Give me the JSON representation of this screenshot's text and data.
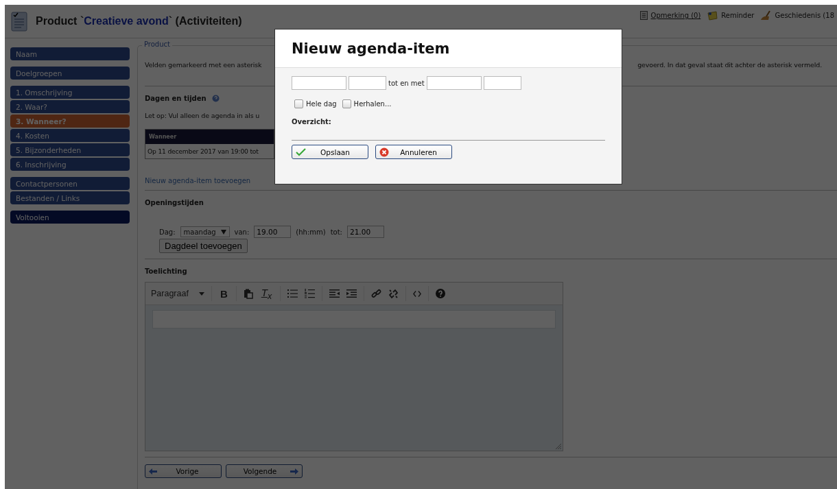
{
  "header": {
    "title_prefix": "Product `",
    "title_name": "Creatieve avond",
    "title_suffix": "` (Activiteiten)",
    "links": [
      {
        "kind": "note",
        "label": "Opmerking (0)"
      },
      {
        "kind": "reminder",
        "label": "Reminder"
      },
      {
        "kind": "history",
        "label": "Geschiedenis (18"
      }
    ]
  },
  "sidebar": {
    "groups": [
      [
        {
          "label": "Naam",
          "selected": false,
          "kind": "step"
        }
      ],
      [
        {
          "label": "Doelgroepen",
          "selected": false,
          "kind": "step"
        }
      ],
      [
        {
          "label": "1. Omschrijving",
          "selected": false,
          "kind": "step"
        },
        {
          "label": "2. Waar?",
          "selected": false,
          "kind": "step"
        },
        {
          "label": "3. Wanneer?",
          "selected": true,
          "kind": "step"
        },
        {
          "label": "4. Kosten",
          "selected": false,
          "kind": "step"
        },
        {
          "label": "5. Bijzonderheden",
          "selected": false,
          "kind": "step"
        },
        {
          "label": "6. Inschrijving",
          "selected": false,
          "kind": "step"
        }
      ],
      [
        {
          "label": "Contactpersonen",
          "selected": false,
          "kind": "step"
        },
        {
          "label": "Bestanden / Links",
          "selected": false,
          "kind": "step"
        }
      ],
      [
        {
          "label": "Voltooien",
          "selected": false,
          "kind": "finish"
        }
      ]
    ]
  },
  "content": {
    "legend": "Product",
    "intro_left": "Velden gemarkeerd met een asterisk",
    "intro_right": "gevoerd. In dat geval staat dit achter de asterisk vermeld.",
    "days_heading": "Dagen en tijden",
    "days_note": "Let op: Vul alleen de agenda in als u",
    "table": {
      "columns": [
        "Wanneer"
      ],
      "rows": [
        [
          "Op 11 december 2017 van 19:00 tot"
        ]
      ]
    },
    "add_link": "Nieuw agenda-item toevoegen",
    "opening": {
      "heading": "Openingstijden",
      "day_label": "Dag:",
      "day_value": "maandag",
      "from_label": "van:",
      "from_value": "19.00",
      "format_hint": "(hh:mm)",
      "to_label": "tot:",
      "to_value": "21.00",
      "add_button": "Dagdeel toevoegen"
    },
    "notes_heading": "Toelichting",
    "editor": {
      "format": "Paragraaf",
      "tools": [
        {
          "kind": "bold",
          "label": "B"
        },
        {
          "kind": "paste"
        },
        {
          "kind": "clear",
          "label": "T$_{x}$"
        },
        {
          "kind": "bullets"
        },
        {
          "kind": "numbers"
        },
        {
          "kind": "outdent"
        },
        {
          "kind": "indent"
        },
        {
          "kind": "link"
        },
        {
          "kind": "unlink"
        },
        {
          "kind": "code"
        },
        {
          "kind": "help"
        }
      ]
    },
    "buttons": [
      {
        "kind": "prev",
        "label": "Vorige"
      },
      {
        "kind": "next",
        "label": "Volgende"
      }
    ]
  },
  "dialog": {
    "title": "Nieuw agenda-item",
    "between": "tot en met",
    "options": [
      {
        "label": "Hele dag",
        "checked": false
      },
      {
        "label": "Herhalen...",
        "checked": false
      }
    ],
    "summary_label": "Overzicht:",
    "buttons": [
      {
        "kind": "save",
        "label": "Opslaan"
      },
      {
        "kind": "cancel",
        "label": "Annuleren"
      }
    ]
  }
}
